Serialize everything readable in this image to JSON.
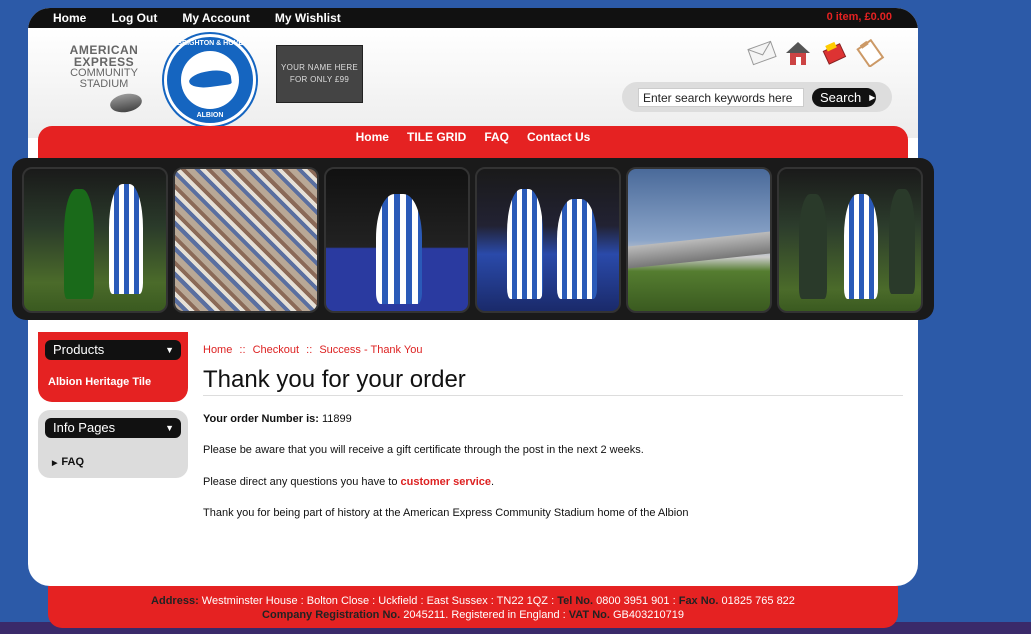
{
  "topnav": {
    "home": "Home",
    "logout": "Log Out",
    "account": "My Account",
    "wishlist": "My Wishlist",
    "cart": "0 item, £0.00"
  },
  "header": {
    "stadium_line1": "AMERICAN",
    "stadium_line2": "EXPRESS",
    "stadium_line3": "COMMUNITY",
    "stadium_line4": "STADIUM",
    "crest_top": "BRIGHTON & HOVE",
    "crest_bottom": "ALBION",
    "tile_line1": "YOUR NAME HERE",
    "tile_line2": "FOR ONLY £99",
    "search_placeholder": "Enter search keywords here",
    "search_label": "Search"
  },
  "mainnav": {
    "items": [
      "Home",
      "TILE GRID",
      "FAQ",
      "Contact Us"
    ]
  },
  "sidebar": {
    "products_title": "Products",
    "products_link": "Albion Heritage Tile",
    "info_title": "Info Pages",
    "info_link": "FAQ"
  },
  "content": {
    "breadcrumb": [
      "Home",
      "Checkout",
      "Success - Thank You"
    ],
    "breadcrumb_sep": "::",
    "title": "Thank you for your order",
    "order_label": "Your order Number is:",
    "order_number": "11899",
    "para1": "Please be aware that you will receive a gift certificate through the post in the next 2 weeks.",
    "para2_prefix": "Please direct any questions you have to",
    "para2_link": "customer service",
    "para2_suffix": ".",
    "para3": "Thank you for being part of history at the American Express Community Stadium home of the Albion"
  },
  "footer": {
    "address_label": "Address:",
    "address": "Westminster House : Bolton Close : Uckfield : East Sussex : TN22 1QZ :",
    "tel_label": "Tel No.",
    "tel": "0800 3951 901 :",
    "fax_label": "Fax No.",
    "fax": "01825 765 822",
    "reg_label": "Company Registration No.",
    "reg": "2045211. Registered in England :",
    "vat_label": "VAT No.",
    "vat": "GB403210719"
  },
  "colors": {
    "brand_red": "#e52222",
    "brand_blue": "#1565c0",
    "background": "#2c5aa8"
  },
  "icons": [
    "email-icon",
    "home-icon",
    "basket-icon",
    "clipboard-icon"
  ]
}
